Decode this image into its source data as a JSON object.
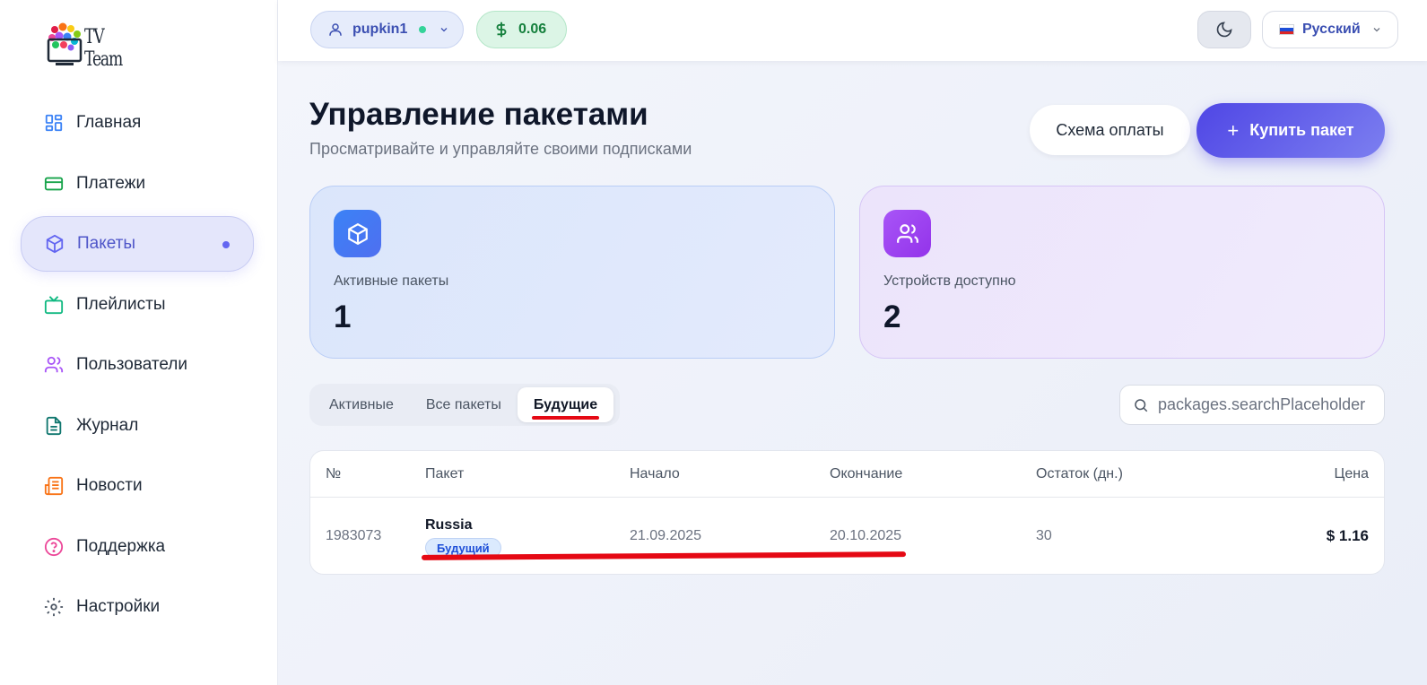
{
  "brand": {
    "name": "TV Team"
  },
  "sidebar": {
    "items": [
      {
        "label": "Главная",
        "icon": "dashboard-icon",
        "color": "#3b82f6"
      },
      {
        "label": "Платежи",
        "icon": "credit-card-icon",
        "color": "#16a34a"
      },
      {
        "label": "Пакеты",
        "icon": "package-icon",
        "color": "#6366f1",
        "active": true
      },
      {
        "label": "Плейлисты",
        "icon": "tv-icon",
        "color": "#10b981"
      },
      {
        "label": "Пользователи",
        "icon": "users-icon",
        "color": "#a855f7"
      },
      {
        "label": "Журнал",
        "icon": "document-icon",
        "color": "#0f766e"
      },
      {
        "label": "Новости",
        "icon": "newspaper-icon",
        "color": "#f97316"
      },
      {
        "label": "Поддержка",
        "icon": "help-circle-icon",
        "color": "#ec4899"
      },
      {
        "label": "Настройки",
        "icon": "gear-icon",
        "color": "#4b5563"
      }
    ]
  },
  "header": {
    "username": "pupkin1",
    "balance": "0.06",
    "language": "Русский"
  },
  "page": {
    "title": "Управление пакетами",
    "subtitle": "Просматривайте и управляйте своими подписками",
    "scheme_button": "Схема оплаты",
    "buy_button": "Купить пакет"
  },
  "stats": [
    {
      "label": "Активные пакеты",
      "value": "1",
      "icon": "package-icon"
    },
    {
      "label": "Устройств доступно",
      "value": "2",
      "icon": "users-icon"
    }
  ],
  "tabs": [
    {
      "label": "Активные",
      "active": false
    },
    {
      "label": "Все пакеты",
      "active": false
    },
    {
      "label": "Будущие",
      "active": true
    }
  ],
  "search": {
    "placeholder": "packages.searchPlaceholder"
  },
  "table": {
    "columns": [
      "№",
      "Пакет",
      "Начало",
      "Окончание",
      "Остаток (дн.)",
      "Цена"
    ],
    "rows": [
      {
        "id": "1983073",
        "package": "Russia",
        "status": "Будущий",
        "start": "21.09.2025",
        "end": "20.10.2025",
        "days_left": "30",
        "price": "$ 1.16"
      }
    ]
  },
  "colors": {
    "accent": "#6366f1",
    "buy_button": "#4f46e5",
    "balance": "#15803d",
    "annotation_red": "#e50914"
  }
}
